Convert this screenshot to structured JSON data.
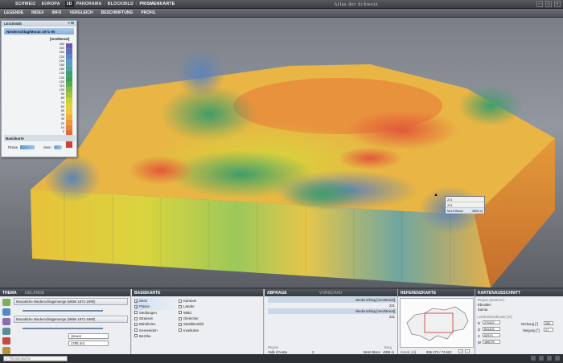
{
  "topbar": {
    "tab1": "SCHWEIZ",
    "tab2": "EUROPA",
    "num": "3D",
    "tab3": "PANORAMA",
    "tab4": "BLOCKBILD",
    "tab5": "PRISMENKARTE",
    "atlas_title": "Atlas der Schweiz"
  },
  "menu": [
    "LEGENDE",
    "INDEX",
    "INFO",
    "VERGLEICH",
    "BESCHRIFTUNG",
    "PROFIL"
  ],
  "legend": {
    "header": "LEGENDE",
    "title": "Niederschlag/Monat 1971-90",
    "unit": "[mm/Monat]",
    "labels": [
      "450",
      "300",
      "260",
      "220",
      "200",
      "180",
      "160",
      "140",
      "130",
      "120",
      "110",
      "100",
      "90",
      "80",
      "70",
      "60",
      "50",
      "40",
      "30",
      "20",
      "10",
      "0"
    ],
    "basis_header": "Basiskarte",
    "basis_fluss": "Flüsse",
    "basis_seen": "Seen"
  },
  "tooltip": {
    "v1": "221",
    "v2": "221",
    "place": "Mont Blanc",
    "height": "4808 m"
  },
  "bottom": {
    "thema_header": "THEMA",
    "gelaende": "GELÄNDE",
    "thema_row1": "Monatliche Niederschlagsmenge (Mittel 1971-1990)",
    "thema_row2": "Monatliche Niederschlagsmenge (Mittel 1971-1990)",
    "month_value": "Januar",
    "year_value": "1785 (m)",
    "basiskarte_header": "BASISKARTE",
    "basis_col1": [
      "Seen",
      "Flüsse",
      "Siedlungen",
      "Strassen",
      "Bahnlinien",
      "Gemeinden",
      "Bezirke"
    ],
    "basis_col2": [
      "Kantone",
      "Länder",
      "Wald",
      "Gletscher",
      "Satellitenbild",
      "Inselkarte"
    ],
    "abfrage_header": "ABFRAGE",
    "vorschau": "VORSCHAU",
    "abf_row1": "Niederschlag [mm/Monat]",
    "abf_row2": "221",
    "abf_row3": "Niederschlag [mm/Monat]",
    "abf_row4": "221",
    "region_label": "Region",
    "region_value": "Valle d'Aosta",
    "region_num": "3",
    "berg_label": "Berg",
    "berg_value": "Mont Blanc",
    "berg_height": "4808 m",
    "ref_header": "REFERENZKARTE",
    "koord_label": "Koord. [m]",
    "koord_value": "555 273 / 73 622",
    "ausschnitt_header": "KARTENAUSSCHNITT",
    "region_label2": "Region (Zentrum)",
    "region_v1": "Ebnalten",
    "region_v2": "Sarnia",
    "landes_label": "Landeskoordinaten [m]",
    "n_label": "N",
    "n_value": "270422",
    "o_label": "O",
    "o_value": "661422",
    "s_label": "S",
    "s_value": "52970",
    "w_label": "W",
    "w_value": "186075",
    "dreh_label": "Drehung [°]",
    "dreh_value": "280",
    "neig_label": "Neigung [°]",
    "neig_value": "17"
  },
  "status": {
    "search_placeholder": "Themensuche"
  }
}
